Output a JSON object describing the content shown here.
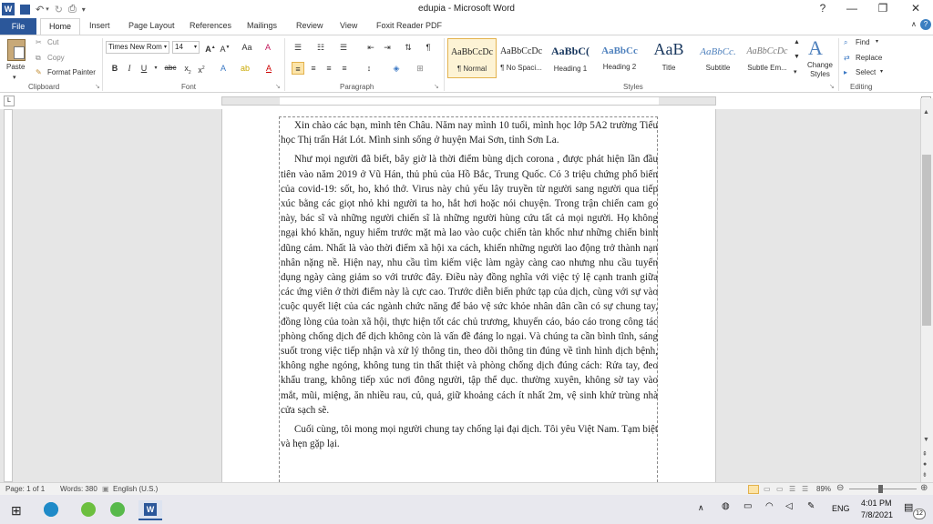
{
  "window": {
    "title": "edupia  -  Microsoft Word",
    "controls": [
      "?",
      "—",
      "❐",
      "✕"
    ]
  },
  "tabs": {
    "file": "File",
    "items": [
      "Home",
      "Insert",
      "Page Layout",
      "References",
      "Mailings",
      "Review",
      "View",
      "Foxit Reader PDF"
    ]
  },
  "clipboard": {
    "paste": "Paste",
    "cut": "Cut",
    "copy": "Copy",
    "format_painter": "Format Painter",
    "label": "Clipboard"
  },
  "font": {
    "name": "Times New Rom",
    "size": "14",
    "label": "Font"
  },
  "paragraph": {
    "label": "Paragraph"
  },
  "styles": {
    "label": "Styles",
    "items": [
      {
        "preview": "AaBbCcDc",
        "name": "¶ Normal"
      },
      {
        "preview": "AaBbCcDc",
        "name": "¶ No Spaci..."
      },
      {
        "preview": "AaBbC(",
        "name": "Heading 1"
      },
      {
        "preview": "AaBbCc",
        "name": "Heading 2"
      },
      {
        "preview": "AaB",
        "name": "Title"
      },
      {
        "preview": "AaBbCc.",
        "name": "Subtitle"
      },
      {
        "preview": "AaBbCcDc",
        "name": "Subtle Em..."
      }
    ],
    "change_styles": "Change Styles"
  },
  "editing": {
    "find": "Find",
    "replace": "Replace",
    "select": "Select",
    "label": "Editing"
  },
  "document": {
    "paragraphs": [
      "Xin chào các bạn, mình tên Châu. Năm nay mình 10 tuổi, mình học lớp 5A2 trường Tiểu học Thị trấn Hát Lót. Mình sinh sống ở huyện Mai Sơn, tỉnh Sơn La.",
      "Như mọi người đã biết, bây giờ là thời điểm bùng dịch corona , được phát hiện lần đầu tiên vào năm 2019 ở Vũ Hán, thủ phủ của Hồ Bắc, Trung Quốc. Có 3 triệu chứng phổ biến của covid-19: sốt, ho, khó thở. Virus này chủ yếu lây truyền từ người sang người qua tiếp xúc bằng các giọt nhỏ khi người ta ho, hắt hơi hoặc nói chuyện. Trong trận chiến cam go này, bác sĩ và những người chiến sĩ là những người hùng cứu tất cả mọi người. Họ không ngại khó khăn, nguy hiểm trước mặt mà lao vào cuộc chiến tàn khốc như những chiến binh dũng cảm. Nhất là vào thời điểm xã hội xa cách, khiến những người lao động trở thành nạn nhân nặng nề. Hiện nay, nhu cầu tìm kiếm việc làm ngày càng cao nhưng nhu cầu tuyển dụng ngày càng giảm so với trước đây. Điều này đồng nghĩa với việc tỷ lệ cạnh tranh giữa các ứng viên ở thời điểm này là cực cao. Trước diễn biến phức tạp của dịch, cùng với sự vào cuộc quyết liệt của các ngành chức năng để bảo vệ sức khỏe nhân dân cần có sự chung tay, đồng lòng của toàn xã hội, thực hiện tốt các chủ trương, khuyến cáo, báo cáo trong công tác phòng chống dịch để dịch không còn là vấn đề đáng lo ngại. Và chúng ta cần bình tĩnh, sáng suốt trong việc tiếp nhận và xử lý thông tin, theo dõi thông tin đúng về tình hình dịch bệnh, không nghe ngóng, không tung tin thất thiệt và phòng chống dịch đúng cách: Rửa tay, đeo khẩu trang, không tiếp xúc nơi đông người, tập thể dục. thường xuyên, không sờ tay vào mắt, mũi, miệng, ăn nhiều rau, củ, quả, giữ khoảng cách ít nhất 2m, vệ sinh khử trùng nhà cửa sạch sẽ.",
      "Cuối cùng, tôi mong mọi người chung tay chống lại đại dịch. Tôi yêu Việt Nam. Tạm biệt và hẹn gặp lại."
    ]
  },
  "status": {
    "page": "Page: 1 of 1",
    "words": "Words: 380",
    "language": "English (U.S.)",
    "zoom": "89%"
  },
  "taskbar": {
    "time": "4:01 PM",
    "date": "7/8/2021",
    "language": "ENG",
    "notification_count": "12"
  }
}
